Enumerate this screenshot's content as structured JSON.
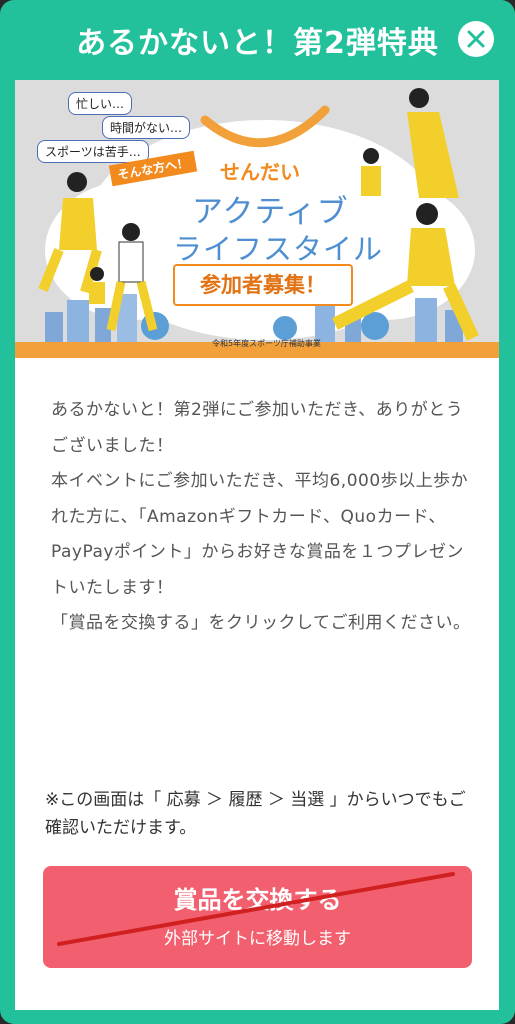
{
  "header": {
    "title": "あるかないと！第2弾特典",
    "close_icon": "close-icon"
  },
  "banner": {
    "bubbles": [
      "忙しい…",
      "時間がない…",
      "スポーツは苦手…"
    ],
    "tag": "そんな方へ！",
    "brand_small": "せんだい",
    "brand_line1": "アクティブ",
    "brand_line2": "ライフスタイル",
    "recruit": "参加者募集！",
    "footnote": "令和5年度スポーツ庁補助事業"
  },
  "body": {
    "paragraphs": [
      "あるかないと！第2弾にご参加いただき、ありがとうございました！",
      "本イベントにご参加いただき、平均6,000歩以上歩かれた方に、「Amazonギフトカード、Quoカード、PayPayポイント」からお好きな賞品を１つプレゼントいたします！",
      "「賞品を交換する」をクリックしてご利用ください。"
    ]
  },
  "note": "※この画面は「 応募 ＞ 履歴 ＞ 当選 」からいつでもご確認いただけます。",
  "cta": {
    "label": "賞品を交換する",
    "sub": "外部サイトに移動します"
  },
  "colors": {
    "frame": "#22c19b",
    "cta": "#f2606f",
    "strike": "#d0201f",
    "brand_orange": "#f28a1e",
    "brand_blue": "#4f8fd1"
  }
}
